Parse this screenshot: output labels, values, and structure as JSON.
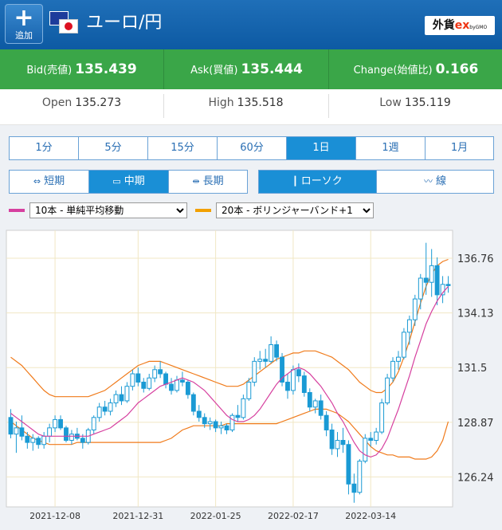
{
  "header": {
    "add_label": "追加",
    "add_icon": "plus-icon",
    "title": "ユーロ/円",
    "brand_main": "外貨",
    "brand_ex": "ex",
    "brand_sub": "byGMO"
  },
  "quote": {
    "bid_label": "Bid(売値)",
    "bid_value": "135.439",
    "ask_label": "Ask(買値)",
    "ask_value": "135.444",
    "change_label": "Change(始値比)",
    "change_value": "0.166"
  },
  "ohl": {
    "open_label": "Open",
    "open_value": "135.273",
    "high_label": "High",
    "high_value": "135.518",
    "low_label": "Low",
    "low_value": "135.119"
  },
  "timeframes": [
    "1分",
    "5分",
    "15分",
    "60分",
    "1日",
    "1週",
    "1月"
  ],
  "timeframe_active": 4,
  "period": {
    "short": "短期",
    "mid": "中期",
    "long": "長期",
    "active": "mid"
  },
  "chart_type": {
    "candle": "ローソク",
    "line": "線",
    "active": "candle"
  },
  "indicators": {
    "ma": {
      "selected": "10本 - 単純平均移動",
      "color": "#d6409f"
    },
    "bb": {
      "selected": "20本 - ボリンジャーバンド+1",
      "color": "#f2a000"
    }
  },
  "colors": {
    "accent": "#1a8fd6",
    "up_green": "#3aa648",
    "candle": "#1a9ad4",
    "ma": "#d6409f",
    "band": "#f07a1a"
  },
  "chart_data": {
    "type": "candlestick",
    "y_ticks": [
      "136.76",
      "134.13",
      "131.5",
      "128.87",
      "126.24"
    ],
    "x_ticks": [
      "2021-12-08",
      "2021-12-31",
      "2022-01-25",
      "2022-02-17",
      "2022-03-14"
    ],
    "ylim": [
      124.8,
      138.1
    ],
    "grid": true,
    "candles": [
      [
        129.1,
        129.5,
        128.1,
        128.3
      ],
      [
        128.3,
        128.9,
        127.4,
        128.6
      ],
      [
        128.6,
        129.2,
        128.0,
        128.2
      ],
      [
        128.2,
        128.4,
        127.6,
        127.9
      ],
      [
        127.9,
        128.3,
        127.5,
        128.1
      ],
      [
        128.1,
        128.2,
        127.6,
        127.8
      ],
      [
        127.8,
        128.4,
        127.6,
        128.2
      ],
      [
        128.2,
        128.8,
        127.9,
        128.6
      ],
      [
        128.6,
        129.2,
        128.4,
        129.0
      ],
      [
        129.0,
        129.2,
        128.5,
        128.6
      ],
      [
        128.6,
        128.7,
        127.9,
        128.0
      ],
      [
        128.0,
        128.5,
        127.8,
        128.3
      ],
      [
        128.3,
        128.6,
        128.0,
        128.1
      ],
      [
        128.1,
        128.3,
        127.6,
        127.9
      ],
      [
        127.9,
        128.6,
        127.8,
        128.5
      ],
      [
        128.5,
        129.2,
        128.3,
        129.1
      ],
      [
        129.1,
        129.8,
        128.9,
        129.6
      ],
      [
        129.6,
        129.9,
        129.2,
        129.4
      ],
      [
        129.4,
        130.0,
        129.2,
        129.8
      ],
      [
        129.8,
        130.4,
        129.6,
        130.2
      ],
      [
        130.2,
        130.6,
        129.7,
        129.9
      ],
      [
        129.9,
        130.8,
        129.8,
        130.6
      ],
      [
        130.6,
        131.4,
        130.4,
        131.2
      ],
      [
        131.2,
        131.5,
        130.6,
        130.8
      ],
      [
        130.8,
        131.0,
        130.3,
        130.5
      ],
      [
        130.5,
        131.2,
        130.4,
        131.0
      ],
      [
        131.0,
        131.6,
        130.8,
        131.4
      ],
      [
        131.4,
        131.8,
        131.0,
        131.2
      ],
      [
        131.2,
        131.3,
        130.5,
        130.7
      ],
      [
        130.7,
        131.0,
        130.2,
        130.4
      ],
      [
        130.4,
        131.1,
        130.3,
        130.9
      ],
      [
        130.9,
        131.3,
        130.6,
        130.8
      ],
      [
        130.8,
        130.9,
        130.0,
        130.2
      ],
      [
        130.2,
        130.3,
        129.2,
        129.4
      ],
      [
        129.4,
        129.7,
        128.9,
        129.1
      ],
      [
        129.1,
        129.3,
        128.6,
        128.8
      ],
      [
        128.8,
        129.1,
        128.5,
        128.9
      ],
      [
        128.9,
        129.0,
        128.4,
        128.6
      ],
      [
        128.6,
        128.9,
        128.3,
        128.7
      ],
      [
        128.7,
        128.8,
        128.3,
        128.5
      ],
      [
        128.5,
        129.3,
        128.4,
        129.2
      ],
      [
        129.2,
        129.7,
        128.9,
        129.1
      ],
      [
        129.1,
        130.2,
        129.0,
        130.0
      ],
      [
        130.0,
        131.0,
        129.9,
        130.8
      ],
      [
        130.8,
        132.0,
        130.6,
        131.8
      ],
      [
        131.8,
        132.3,
        131.4,
        131.9
      ],
      [
        131.9,
        132.4,
        131.5,
        131.8
      ],
      [
        131.8,
        133.0,
        131.7,
        132.6
      ],
      [
        132.6,
        132.8,
        131.8,
        132.0
      ],
      [
        132.0,
        132.2,
        130.6,
        130.8
      ],
      [
        130.8,
        131.2,
        130.0,
        130.4
      ],
      [
        130.4,
        131.6,
        130.2,
        131.4
      ],
      [
        131.4,
        131.7,
        130.8,
        131.1
      ],
      [
        131.1,
        131.3,
        130.1,
        130.3
      ],
      [
        130.3,
        130.5,
        129.4,
        129.6
      ],
      [
        129.6,
        130.0,
        129.3,
        129.9
      ],
      [
        129.9,
        130.2,
        129.0,
        129.2
      ],
      [
        129.2,
        129.4,
        128.2,
        128.5
      ],
      [
        128.5,
        128.8,
        127.3,
        127.6
      ],
      [
        127.6,
        128.4,
        127.2,
        128.0
      ],
      [
        128.0,
        128.6,
        127.4,
        127.8
      ],
      [
        127.8,
        128.0,
        125.4,
        125.9
      ],
      [
        125.9,
        126.4,
        125.0,
        125.5
      ],
      [
        125.5,
        127.1,
        125.4,
        127.0
      ],
      [
        127.0,
        128.3,
        126.9,
        128.1
      ],
      [
        128.1,
        128.4,
        127.7,
        128.0
      ],
      [
        128.0,
        128.6,
        127.8,
        128.4
      ],
      [
        128.4,
        130.0,
        128.3,
        129.8
      ],
      [
        129.8,
        131.2,
        129.7,
        131.0
      ],
      [
        131.0,
        132.0,
        130.8,
        131.8
      ],
      [
        131.8,
        132.3,
        131.4,
        132.0
      ],
      [
        132.0,
        133.4,
        131.9,
        133.2
      ],
      [
        133.2,
        134.0,
        132.6,
        133.8
      ],
      [
        133.8,
        135.0,
        133.5,
        134.8
      ],
      [
        134.8,
        136.0,
        134.3,
        135.8
      ],
      [
        135.8,
        137.5,
        135.0,
        135.6
      ],
      [
        135.6,
        137.2,
        134.9,
        136.4
      ],
      [
        136.4,
        136.8,
        134.5,
        135.0
      ],
      [
        135.0,
        135.9,
        134.6,
        135.5
      ],
      [
        135.5,
        135.9,
        135.1,
        135.44
      ]
    ],
    "ma10": [
      129.3,
      129.1,
      128.9,
      128.7,
      128.5,
      128.3,
      128.2,
      128.2,
      128.2,
      128.2,
      128.2,
      128.2,
      128.2,
      128.2,
      128.2,
      128.3,
      128.4,
      128.5,
      128.6,
      128.8,
      129.0,
      129.2,
      129.5,
      129.8,
      130.0,
      130.2,
      130.4,
      130.6,
      130.7,
      130.8,
      130.9,
      131.0,
      130.9,
      130.8,
      130.6,
      130.4,
      130.1,
      129.8,
      129.5,
      129.2,
      129.0,
      128.9,
      128.9,
      129.0,
      129.2,
      129.5,
      129.9,
      130.3,
      130.7,
      131.0,
      131.2,
      131.4,
      131.5,
      131.4,
      131.2,
      130.9,
      130.6,
      130.2,
      129.8,
      129.3,
      128.9,
      128.4,
      127.9,
      127.5,
      127.3,
      127.2,
      127.3,
      127.6,
      128.1,
      128.8,
      129.5,
      130.3,
      131.1,
      132.0,
      132.8,
      133.6,
      134.2,
      134.7,
      135.1,
      135.4
    ],
    "bb_upper": [
      132.0,
      131.8,
      131.6,
      131.3,
      131.0,
      130.7,
      130.4,
      130.2,
      130.1,
      130.1,
      130.1,
      130.1,
      130.1,
      130.1,
      130.1,
      130.2,
      130.3,
      130.4,
      130.6,
      130.8,
      131.0,
      131.2,
      131.4,
      131.6,
      131.7,
      131.8,
      131.8,
      131.8,
      131.7,
      131.6,
      131.5,
      131.4,
      131.3,
      131.2,
      131.1,
      131.0,
      130.9,
      130.8,
      130.7,
      130.6,
      130.6,
      130.6,
      130.7,
      130.9,
      131.1,
      131.3,
      131.5,
      131.7,
      131.9,
      132.0,
      132.1,
      132.2,
      132.2,
      132.3,
      132.3,
      132.3,
      132.2,
      132.1,
      132.0,
      131.8,
      131.6,
      131.4,
      131.1,
      130.8,
      130.6,
      130.4,
      130.3,
      130.3,
      130.5,
      130.8,
      131.3,
      132.0,
      132.8,
      133.7,
      134.6,
      135.4,
      136.0,
      136.4,
      136.6,
      136.7
    ],
    "bb_lower": [
      128.9,
      128.7,
      128.5,
      128.3,
      128.1,
      128.0,
      127.9,
      127.8,
      127.8,
      127.8,
      127.8,
      127.8,
      127.9,
      127.9,
      127.9,
      127.9,
      127.9,
      127.9,
      127.9,
      127.9,
      127.9,
      127.9,
      127.9,
      127.9,
      127.9,
      127.9,
      127.9,
      127.9,
      128.0,
      128.1,
      128.3,
      128.5,
      128.6,
      128.7,
      128.7,
      128.7,
      128.7,
      128.7,
      128.7,
      128.8,
      128.8,
      128.8,
      128.8,
      128.8,
      128.8,
      128.8,
      128.8,
      128.8,
      128.8,
      128.9,
      129.0,
      129.1,
      129.2,
      129.3,
      129.4,
      129.5,
      129.5,
      129.5,
      129.4,
      129.3,
      129.1,
      128.9,
      128.6,
      128.3,
      128.0,
      127.7,
      127.5,
      127.4,
      127.3,
      127.3,
      127.2,
      127.2,
      127.2,
      127.1,
      127.1,
      127.1,
      127.2,
      127.5,
      128.0,
      128.9
    ]
  }
}
